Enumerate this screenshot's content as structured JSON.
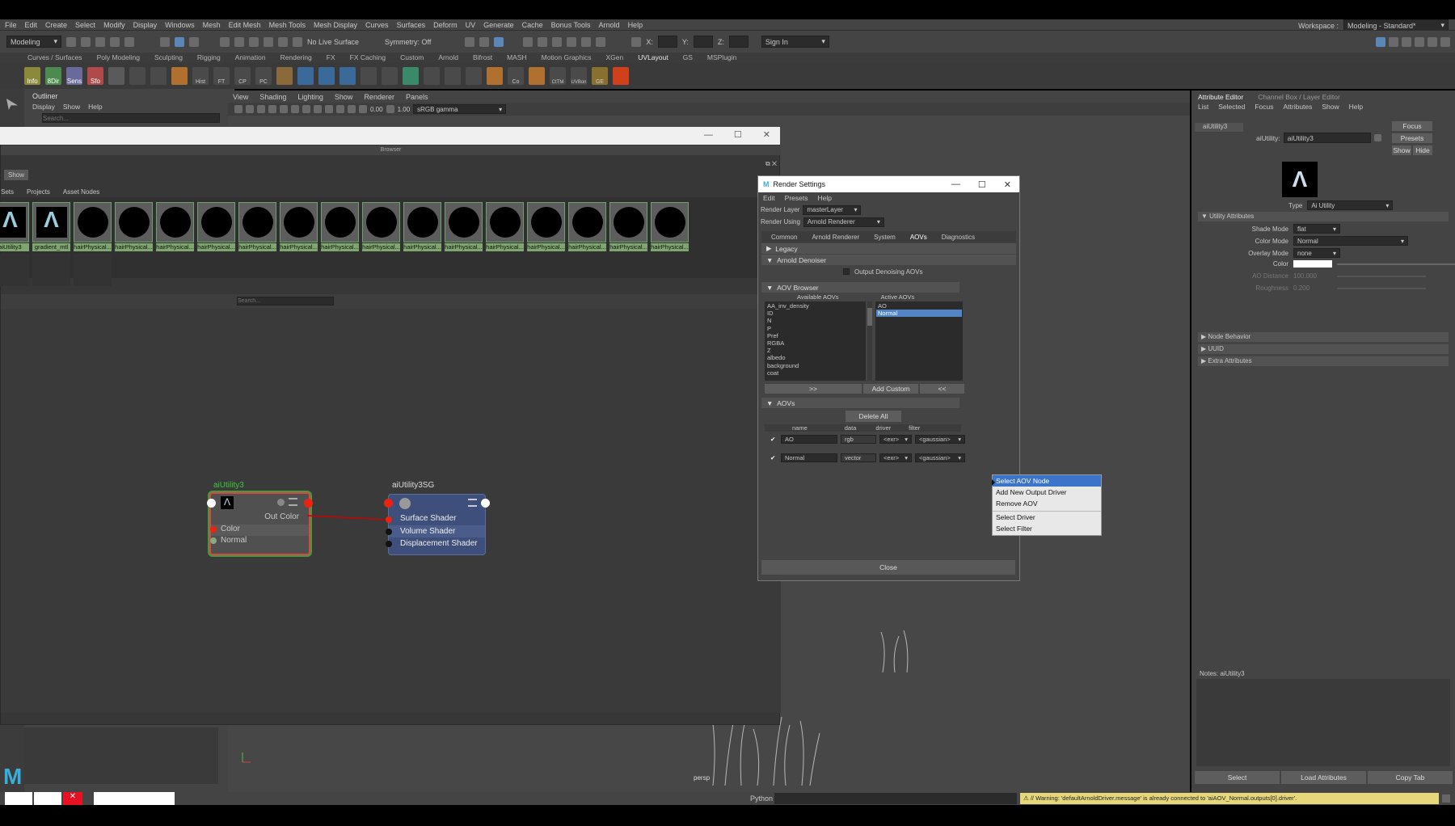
{
  "menubar": {
    "items": [
      "File",
      "Edit",
      "Create",
      "Select",
      "Modify",
      "Display",
      "Windows",
      "Mesh",
      "Edit Mesh",
      "Mesh Tools",
      "Mesh Display",
      "Curves",
      "Surfaces",
      "Deform",
      "UV",
      "Generate",
      "Cache",
      "Bonus Tools",
      "Arnold",
      "Help"
    ],
    "workspace_label": "Workspace :",
    "workspace_value": "Modeling - Standard*"
  },
  "statusline": {
    "mode": "Modeling",
    "live_surface": "No Live Surface",
    "symmetry": "Symmetry: Off",
    "x_label": "X:",
    "y_label": "Y:",
    "z_label": "Z:",
    "sign_in": "Sign In"
  },
  "shelf": {
    "tabs": [
      "Curves / Surfaces",
      "Poly Modeling",
      "Sculpting",
      "Rigging",
      "Animation",
      "Rendering",
      "FX",
      "FX Caching",
      "Custom",
      "Arnold",
      "Bifrost",
      "MASH",
      "Motion Graphics",
      "XGen",
      "UVLayout",
      "GS",
      "MSPlugin"
    ],
    "active_tab": "UVLayout",
    "tools": [
      "Info",
      "8Dir",
      "Sens",
      "Sfo",
      "Hist",
      "FT",
      "CP",
      "PC",
      "Co",
      "CtTM",
      "UVBon",
      "GE"
    ]
  },
  "outliner": {
    "title": "Outliner",
    "menu": [
      "Display",
      "Show",
      "Help"
    ],
    "search_placeholder": "Search..."
  },
  "viewport": {
    "menu": [
      "View",
      "Shading",
      "Lighting",
      "Show",
      "Renderer",
      "Panels"
    ],
    "exposure": "0.00",
    "gamma": "1.00",
    "color_space": "sRGB gamma",
    "camera": "persp"
  },
  "hypershade": {
    "browser_label": "Browser",
    "show_label": "Show",
    "tabs": [
      "Sets",
      "Projects",
      "Asset Nodes"
    ],
    "swatches": [
      "aiUtility3",
      "gradient_mtl",
      "hairPhysical...",
      "hairPhysical...",
      "hairPhysical...",
      "hairPhysical...",
      "hairPhysical...",
      "hairPhysical...",
      "hairPhysical...",
      "hairPhysical...",
      "hairPhysical...",
      "hairPhysical...",
      "hairPhysical...",
      "hairPhysical...",
      "hairPhysical...",
      "hairPhysical...",
      "hairPhysical..."
    ],
    "search_placeholder": "Search...",
    "node1": {
      "title": "aiUtility3",
      "out": "Out Color",
      "inputs": [
        "Color",
        "Normal"
      ]
    },
    "node2": {
      "title": "aiUtility3SG",
      "inputs": [
        "Surface Shader",
        "Volume Shader",
        "Displacement Shader"
      ]
    }
  },
  "render_settings": {
    "title": "Render Settings",
    "menu": [
      "Edit",
      "Presets",
      "Help"
    ],
    "render_layer_label": "Render Layer",
    "render_layer_value": "masterLayer",
    "render_using_label": "Render Using",
    "render_using_value": "Arnold Renderer",
    "tabs": [
      "Common",
      "Arnold Renderer",
      "System",
      "AOVs",
      "Diagnostics"
    ],
    "active_tab": "AOVs",
    "legacy": "Legacy",
    "denoiser": "Arnold Denoiser",
    "output_denoising": "Output Denoising AOVs",
    "aov_browser": "AOV Browser",
    "available_header": "Available AOVs",
    "active_header": "Active AOVs",
    "available": [
      "AA_inv_density",
      "ID",
      "N",
      "P",
      "Pref",
      "RGBA",
      "Z",
      "albedo",
      "background",
      "coat"
    ],
    "active": [
      "AO",
      "Normal"
    ],
    "btn_add": ">>",
    "btn_custom": "Add Custom",
    "btn_remove": "<<",
    "aovs_section": "AOVs",
    "delete_all": "Delete All",
    "cols": [
      "name",
      "data",
      "driver",
      "filter"
    ],
    "rows": [
      {
        "name": "AO",
        "data": "rgb",
        "driver": "<exr>",
        "filter": "<gaussian>"
      },
      {
        "name": "Normal",
        "data": "vector",
        "driver": "<exr>",
        "filter": "<gaussian>"
      }
    ],
    "close": "Close"
  },
  "context_menu": {
    "items": [
      "Select AOV Node",
      "Add New Output Driver",
      "Remove AOV",
      "Select Driver",
      "Select Filter"
    ]
  },
  "attribute_editor": {
    "tabs": [
      "Attribute Editor",
      "Channel Box / Layer Editor"
    ],
    "menu": [
      "List",
      "Selected",
      "Focus",
      "Attributes",
      "Show",
      "Help"
    ],
    "node_tab": "aiUtility3",
    "node_label": "aiUtility:",
    "node_value": "aiUtility3",
    "focus": "Focus",
    "presets": "Presets",
    "show": "Show",
    "hide": "Hide",
    "type_label": "Type",
    "type_value": "Ai Utility",
    "utility_section": "Utility Attributes",
    "shade_mode_label": "Shade Mode",
    "shade_mode_value": "flat",
    "color_mode_label": "Color Mode",
    "color_mode_value": "Normal",
    "overlay_label": "Overlay Mode",
    "overlay_value": "none",
    "color_label": "Color",
    "ao_label": "AO Distance",
    "ao_value": "100.000",
    "rough_label": "Roughness",
    "rough_value": "0.200",
    "sections": [
      "Node Behavior",
      "UUID",
      "Extra Attributes"
    ],
    "notes": "Notes: aiUtility3",
    "buttons": [
      "Select",
      "Load Attributes",
      "Copy Tab"
    ]
  },
  "bottom": {
    "python": "Python",
    "warning": "// Warning: 'defaultArnoldDriver.message' is already connected to 'aiAOV_Normal.outputs[0].driver'."
  }
}
